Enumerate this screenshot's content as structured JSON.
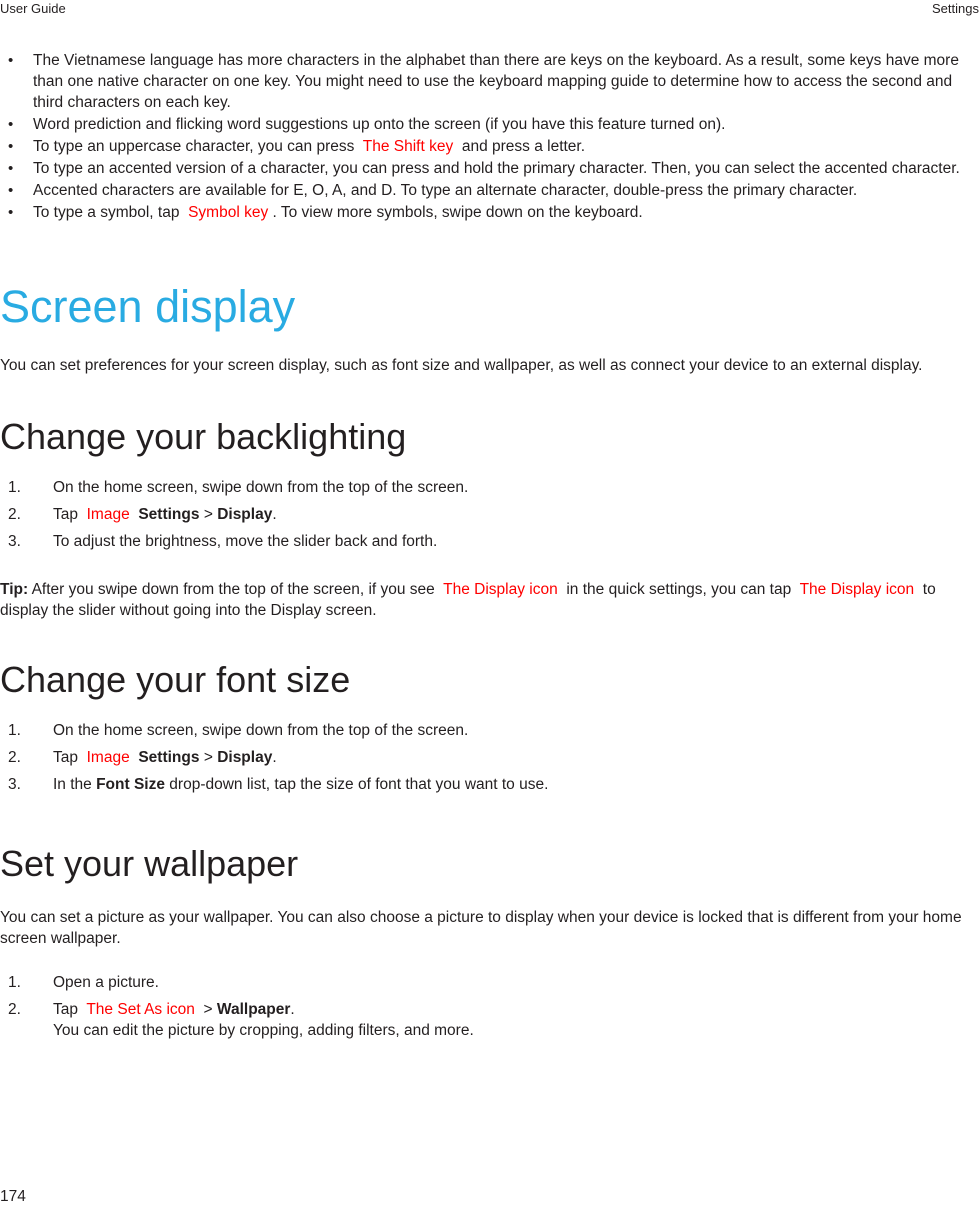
{
  "header": {
    "left": "User Guide",
    "right": "Settings"
  },
  "colors": {
    "accent_blue": "#29abe2",
    "placeholder_red": "#ff0000",
    "body_text": "#231f20"
  },
  "keyboard_bullets": {
    "items": [
      {
        "text": "The Vietnamese language has more characters in the alphabet than there are keys on the keyboard. As a result, some keys have more than one native character on one key. You might need to use the keyboard mapping guide to determine how to access the second and third characters on each key."
      },
      {
        "text": "Word prediction and flicking word suggestions up onto the screen (if you have this feature turned on)."
      },
      {
        "pre": "To type an uppercase character, you can press",
        "placeholder": "The Shift key",
        "post": "and press a letter."
      },
      {
        "text": "To type an accented version of a character, you can press and hold the primary character. Then, you can select the accented character."
      },
      {
        "text": "Accented characters are available for E, O, A, and D. To type an alternate character, double-press the primary character."
      },
      {
        "pre": "To type a symbol, tap",
        "placeholder": "Symbol key",
        "post": ". To view more symbols, swipe down on the keyboard."
      }
    ],
    "bullet_glyph": "•"
  },
  "screen_display": {
    "title": "Screen display",
    "intro": "You can set preferences for your screen display, such as font size and wallpaper, as well as connect your device to an external display."
  },
  "backlighting": {
    "title": "Change your backlighting",
    "steps": [
      {
        "num": "1.",
        "text": "On the home screen, swipe down from the top of the screen."
      },
      {
        "num": "2.",
        "tap_label": "Tap",
        "placeholder": "Image",
        "bold1": "Settings",
        "separator": ">",
        "bold2": "Display",
        "period": "."
      },
      {
        "num": "3.",
        "text": "To adjust the brightness, move the slider back and forth."
      }
    ],
    "tip": {
      "label": "Tip:",
      "part1": "After you swipe down from the top of the screen, if you see",
      "placeholder1": "The Display icon",
      "part2": "in the quick settings, you can tap",
      "placeholder2": "The Display icon",
      "part3": "to display the slider without going into the Display screen."
    }
  },
  "font_size": {
    "title": "Change your font size",
    "steps": [
      {
        "num": "1.",
        "text": "On the home screen, swipe down from the top of the screen."
      },
      {
        "num": "2.",
        "tap_label": "Tap",
        "placeholder": "Image",
        "bold1": "Settings",
        "separator": ">",
        "bold2": "Display",
        "period": "."
      },
      {
        "num": "3.",
        "pre": "In the",
        "bold": "Font Size",
        "post": "drop-down list, tap the size of font that you want to use."
      }
    ]
  },
  "wallpaper": {
    "title": "Set your wallpaper",
    "intro": "You can set a picture as your wallpaper. You can also choose a picture to display when your device is locked that is different from your home screen wallpaper.",
    "steps": [
      {
        "num": "1.",
        "text": "Open a picture."
      },
      {
        "num": "2.",
        "tap_label": "Tap",
        "placeholder": "The Set As icon",
        "separator": ">",
        "bold": "Wallpaper",
        "period": ".",
        "sub": "You can edit the picture by cropping, adding filters, and more."
      }
    ]
  },
  "footer": {
    "page_number": "174"
  }
}
